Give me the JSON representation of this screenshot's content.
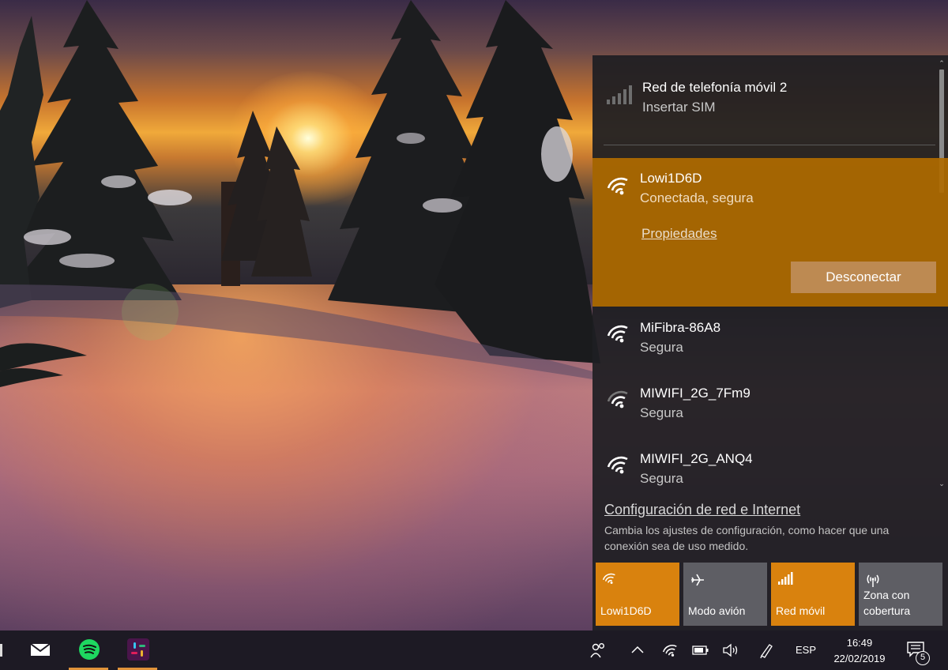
{
  "cellular": {
    "title": "Red de telefonía móvil 2",
    "status": "Insertar SIM"
  },
  "connected_network": {
    "ssid": "Lowi1D6D",
    "status": "Conectada, segura",
    "properties_label": "Propiedades",
    "disconnect_label": "Desconectar"
  },
  "networks": [
    {
      "ssid": "MiFibra-86A8",
      "status": "Segura"
    },
    {
      "ssid": "MIWIFI_2G_7Fm9",
      "status": "Segura"
    },
    {
      "ssid": "MIWIFI_2G_ANQ4",
      "status": "Segura"
    }
  ],
  "settings": {
    "link": "Configuración de red e Internet",
    "description": "Cambia los ajustes de configuración, como hacer que una conexión sea de uso medido."
  },
  "quick_actions": [
    {
      "label": "Lowi1D6D",
      "icon": "wifi-icon",
      "state": "on"
    },
    {
      "label": "Modo avión",
      "icon": "airplane-icon",
      "state": "off"
    },
    {
      "label": "Red móvil",
      "icon": "cellular-icon",
      "state": "on"
    },
    {
      "label": "Zona con cobertura",
      "icon": "hotspot-icon",
      "state": "off"
    }
  ],
  "taskbar": {
    "apps": [
      {
        "name": "mail-app-icon"
      },
      {
        "name": "spotify-app-icon"
      },
      {
        "name": "slack-app-icon"
      }
    ],
    "language": "ESP",
    "time": "16:49",
    "date": "22/02/2019",
    "notification_count": "5"
  },
  "colors": {
    "accent": "#AE6A00",
    "tile_on": "#D9820E",
    "tile_off": "#5E5E64",
    "flyout_bg": "#1E1E22"
  }
}
